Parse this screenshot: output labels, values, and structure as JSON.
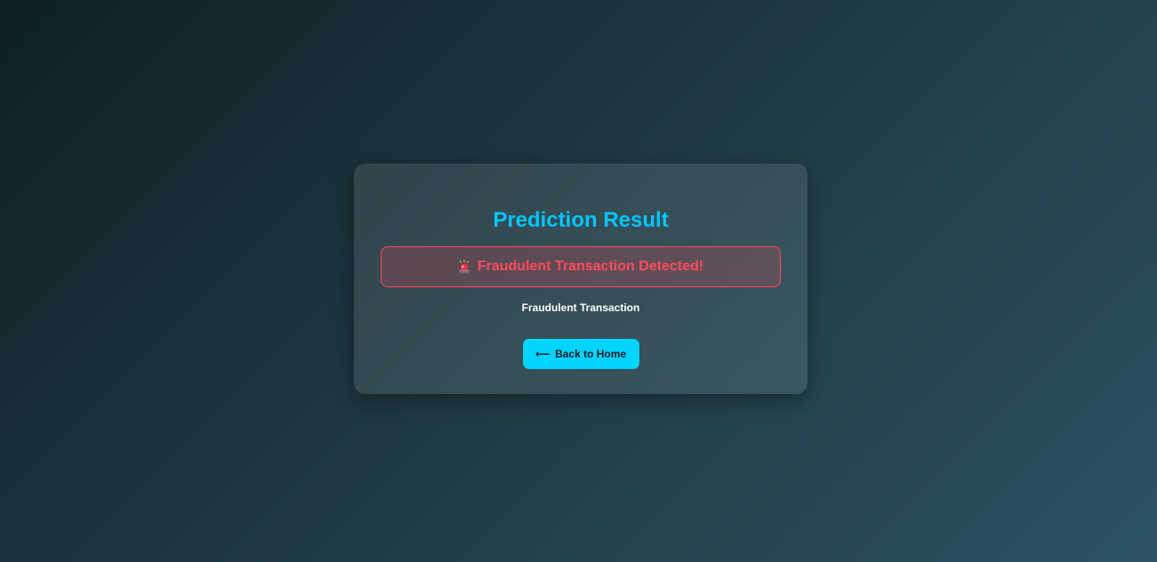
{
  "page": {
    "title": "Prediction Result"
  },
  "result": {
    "alert_icon": "police-siren-icon",
    "alert_text": "Fraudulent Transaction Detected!",
    "detail_text": "Fraudulent Transaction"
  },
  "actions": {
    "back_arrow": "⟵",
    "back_label": "Back to Home"
  },
  "colors": {
    "accent": "#00c6ff",
    "alert": "#ff4b5c",
    "button": "#00d4ff",
    "background_start": "#0f2027",
    "background_end": "#2c5364"
  }
}
